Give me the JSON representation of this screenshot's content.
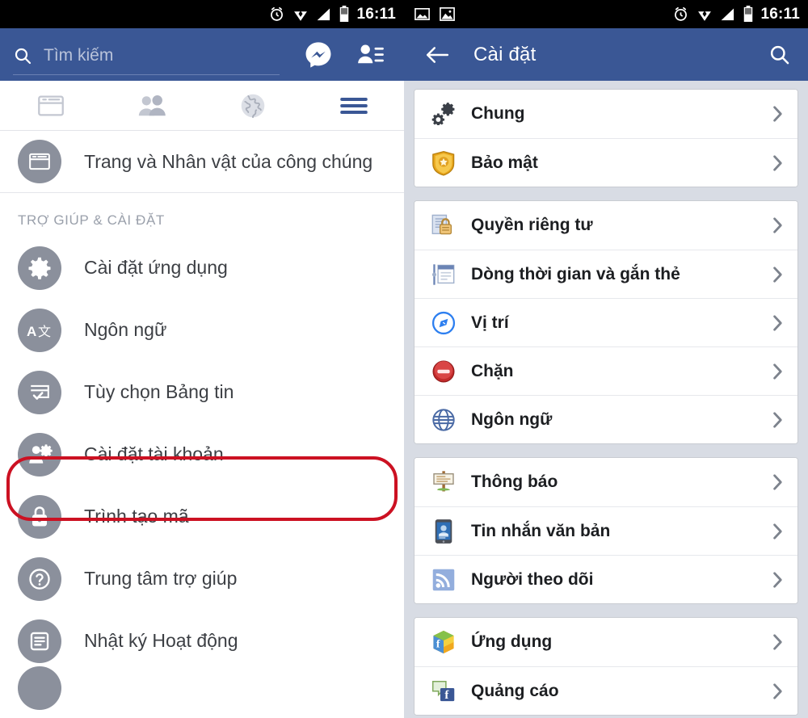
{
  "status_bar": {
    "time": "16:11",
    "left_icons_right_pane": [
      "image-icon",
      "picture-icon"
    ],
    "right_icons": [
      "alarm-icon",
      "wifi-icon",
      "signal-icon",
      "battery-icon"
    ]
  },
  "left_pane": {
    "search": {
      "placeholder": "Tìm kiếm",
      "value": ""
    },
    "actions": [
      {
        "name": "messenger-icon",
        "label": "Messenger"
      },
      {
        "name": "friend-requests-icon",
        "label": "Lời mời kết bạn"
      }
    ],
    "tabs": [
      {
        "name": "tab-news-feed",
        "icon": "news-feed-icon",
        "active": false
      },
      {
        "name": "tab-friends",
        "icon": "friends-icon",
        "active": false
      },
      {
        "name": "tab-globe",
        "icon": "globe-icon",
        "active": false
      },
      {
        "name": "tab-menu",
        "icon": "hamburger-menu-icon",
        "active": true
      }
    ],
    "top_item": {
      "label": "Trang và Nhân vật của công chúng",
      "icon": "pages-icon"
    },
    "section_title": "TRỢ GIÚP & CÀI ĐẶT",
    "items": [
      {
        "label": "Cài đặt ứng dụng",
        "icon": "gear-icon"
      },
      {
        "label": "Ngôn ngữ",
        "icon": "translate-icon"
      },
      {
        "label": "Tùy chọn Bảng tin",
        "icon": "feed-preferences-icon"
      },
      {
        "label": "Cài đặt tài khoản",
        "icon": "account-settings-icon",
        "highlighted": true
      },
      {
        "label": "Trình tạo mã",
        "icon": "code-generator-lock-icon"
      },
      {
        "label": "Trung tâm trợ giúp",
        "icon": "question-mark-icon"
      },
      {
        "label": "Nhật ký Hoạt động",
        "icon": "activity-log-icon"
      },
      {
        "label": "",
        "icon": "partial-icon"
      }
    ]
  },
  "right_pane": {
    "header": {
      "back": "back-arrow-icon",
      "title": "Cài đặt",
      "search": "search-icon"
    },
    "groups": [
      {
        "items": [
          {
            "label": "Chung",
            "icon": "gears-icon"
          },
          {
            "label": "Bảo mật",
            "icon": "shield-badge-icon",
            "highlighted": true
          }
        ]
      },
      {
        "items": [
          {
            "label": "Quyền riêng tư",
            "icon": "privacy-lock-icon"
          },
          {
            "label": "Dòng thời gian và gắn thẻ",
            "icon": "timeline-tagging-icon"
          },
          {
            "label": "Vị trí",
            "icon": "compass-location-icon"
          },
          {
            "label": "Chặn",
            "icon": "block-icon"
          },
          {
            "label": "Ngôn ngữ",
            "icon": "globe-language-icon"
          }
        ]
      },
      {
        "items": [
          {
            "label": "Thông báo",
            "icon": "notification-signpost-icon"
          },
          {
            "label": "Tin nhắn văn bản",
            "icon": "text-message-phone-icon"
          },
          {
            "label": "Người theo dõi",
            "icon": "followers-rss-icon"
          }
        ]
      },
      {
        "items": [
          {
            "label": "Ứng dụng",
            "icon": "apps-cube-icon"
          },
          {
            "label": "Quảng cáo",
            "icon": "ads-icon"
          }
        ]
      }
    ],
    "chevron": "chevron-right-icon"
  },
  "colors": {
    "facebook_blue": "#3a5795",
    "status_bar_black": "#000000",
    "highlight_red": "#cc1122",
    "page_background": "#d8dce4",
    "icon_circle_grey": "#8b909c"
  }
}
